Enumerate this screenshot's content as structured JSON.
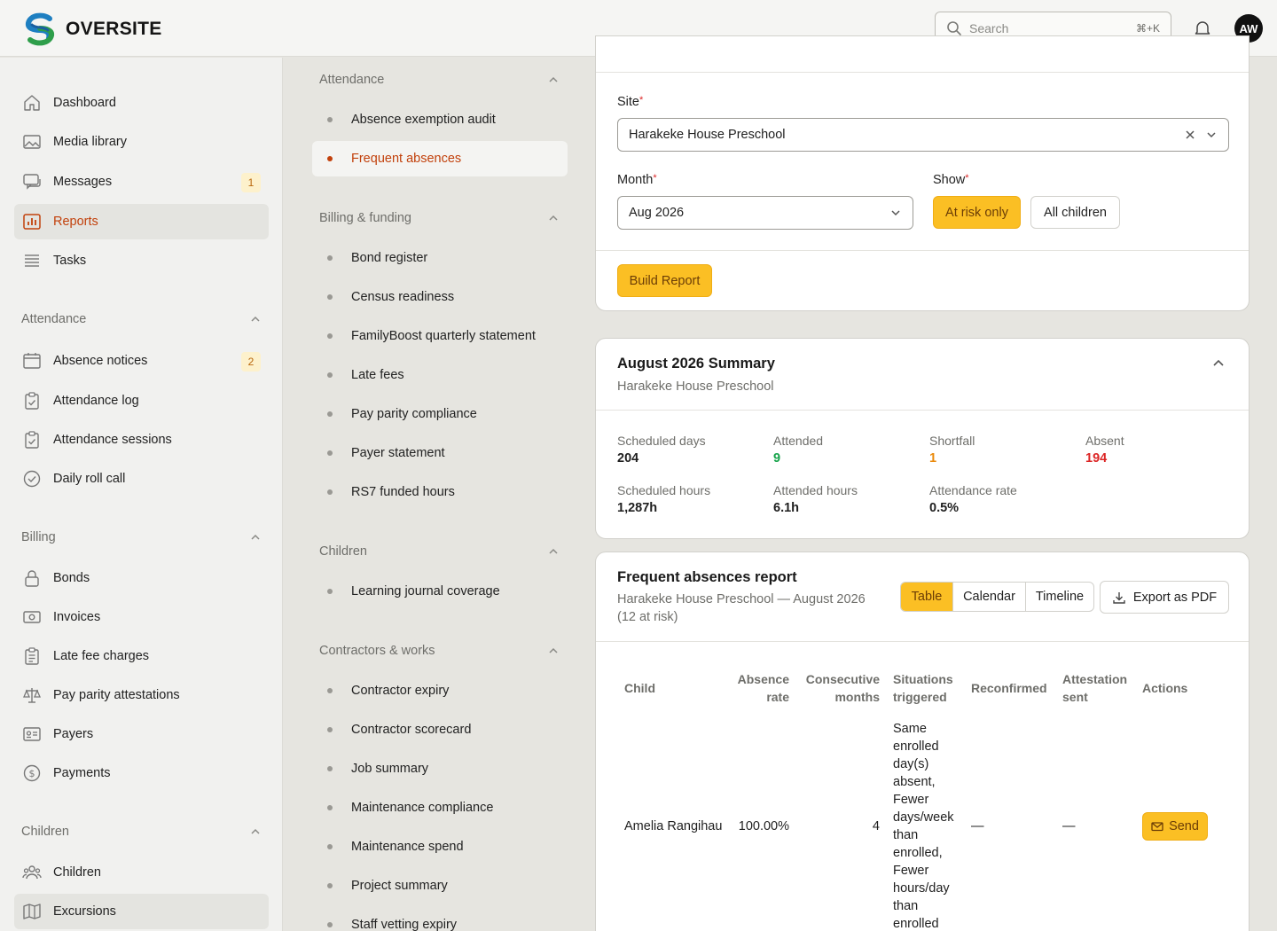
{
  "app": {
    "name": "OVERSITE"
  },
  "search": {
    "placeholder": "Search",
    "shortcut": "⌘+K"
  },
  "user": {
    "initials": "AW"
  },
  "sidebar": {
    "primary": [
      {
        "label": "Dashboard",
        "icon": "home-icon"
      },
      {
        "label": "Media library",
        "icon": "image-icon"
      },
      {
        "label": "Messages",
        "icon": "chat-icon",
        "badge": "1"
      },
      {
        "label": "Reports",
        "icon": "chart-icon"
      },
      {
        "label": "Tasks",
        "icon": "list-icon"
      }
    ],
    "attendance": {
      "title": "Attendance",
      "items": [
        "Absence notices",
        "Attendance log",
        "Attendance sessions",
        "Daily roll call"
      ],
      "badge": "2"
    },
    "billing": {
      "title": "Billing",
      "items": [
        "Bonds",
        "Invoices",
        "Late fee charges",
        "Pay parity attestations",
        "Payers",
        "Payments"
      ]
    },
    "children": {
      "title": "Children",
      "items": [
        "Children",
        "Excursions"
      ]
    }
  },
  "reports_nav": {
    "attendance": {
      "title": "Attendance",
      "items": [
        "Absence exemption audit",
        "Frequent absences"
      ]
    },
    "billing": {
      "title": "Billing & funding",
      "items": [
        "Bond register",
        "Census readiness",
        "FamilyBoost quarterly statement",
        "Late fees",
        "Pay parity compliance",
        "Payer statement",
        "RS7 funded hours"
      ]
    },
    "children": {
      "title": "Children",
      "items": [
        "Learning journal coverage"
      ]
    },
    "contractors": {
      "title": "Contractors & works",
      "items": [
        "Contractor expiry",
        "Contractor scorecard",
        "Job summary",
        "Maintenance compliance",
        "Maintenance spend",
        "Project summary",
        "Staff vetting expiry"
      ]
    }
  },
  "form": {
    "site_label": "Site",
    "site_value": "Harakeke House Preschool",
    "month_label": "Month",
    "month_value": "Aug 2026",
    "show_label": "Show",
    "show_options": [
      "At risk only",
      "All children"
    ],
    "build_label": "Build Report"
  },
  "summary": {
    "title": "August 2026 Summary",
    "subtitle": "Harakeke House Preschool",
    "stats": [
      {
        "label": "Scheduled days",
        "value": "204"
      },
      {
        "label": "Attended",
        "value": "9"
      },
      {
        "label": "Shortfall",
        "value": "1"
      },
      {
        "label": "Absent",
        "value": "194"
      },
      {
        "label": "Scheduled hours",
        "value": "1,287h"
      },
      {
        "label": "Attended hours",
        "value": "6.1h"
      },
      {
        "label": "Attendance rate",
        "value": "0.5%"
      }
    ],
    "colors": {
      "attended": "#16a34a",
      "shortfall": "#ea8a0c",
      "absent": "#dc2626"
    }
  },
  "report": {
    "title": "Frequent absences report",
    "subtitle_line1": "Harakeke House Preschool — August 2026",
    "subtitle_line2": "(12 at risk)",
    "views": [
      "Table",
      "Calendar",
      "Timeline"
    ],
    "export_label": "Export as PDF",
    "columns": {
      "child": "Child",
      "absence_rate_1": "Absence",
      "absence_rate_2": "rate",
      "consecutive_1": "Consecutive",
      "consecutive_2": "months",
      "situations_1": "Situations",
      "situations_2": "triggered",
      "reconfirmed": "Reconfirmed",
      "attestation_1": "Attestation",
      "attestation_2": "sent",
      "actions": "Actions"
    },
    "rows": [
      {
        "child": "Amelia Rangihau",
        "absence_rate": "100.00%",
        "consecutive": "4",
        "situations": [
          "Same",
          "enrolled",
          "day(s)",
          "absent,",
          "Fewer",
          "days/week",
          "than",
          "enrolled,",
          "Fewer",
          "hours/day",
          "than",
          "enrolled"
        ],
        "reconfirmed": "—",
        "attestation": "—",
        "action": "Send"
      }
    ]
  },
  "accent": "#c2410c"
}
